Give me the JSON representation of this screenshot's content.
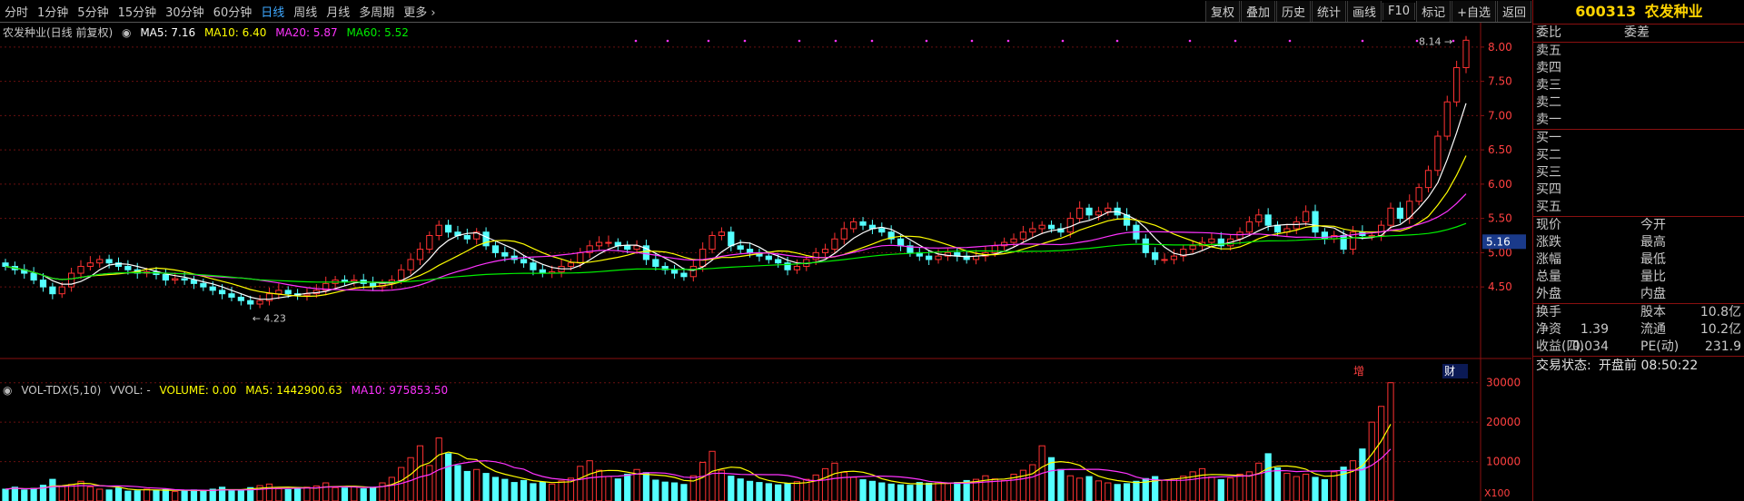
{
  "toolbar": {
    "periods": [
      "分时",
      "1分钟",
      "5分钟",
      "15分钟",
      "30分钟",
      "60分钟",
      "日线",
      "周线",
      "月线",
      "多周期",
      "更多"
    ],
    "more_chevron": "›",
    "active_period": "日线",
    "right_tools": [
      "复权",
      "叠加",
      "历史",
      "统计",
      "画线",
      "F10",
      "标记",
      "+自选",
      "返回"
    ]
  },
  "main_legend": {
    "title": "农发种业(日线 前复权)",
    "ma5": "MA5: 7.16",
    "ma10": "MA10: 6.40",
    "ma20": "MA20: 5.87",
    "ma60": "MA60: 5.52"
  },
  "vol_legend": {
    "name": "VOL-TDX(5,10)",
    "vvol": "VVOL: -",
    "volume": "VOLUME: 0.00",
    "ma5": "MA5: 1442900.63",
    "ma10": "MA10: 975853.50"
  },
  "chart_data": {
    "type": "candlestick",
    "price_axis": {
      "ticks": [
        "8.00",
        "7.50",
        "7.00",
        "6.50",
        "6.00",
        "5.50",
        "5.00",
        "4.50"
      ],
      "ylim": [
        4.25,
        8.25
      ]
    },
    "volume_axis": {
      "ticks": [
        "30000",
        "20000",
        "10000"
      ],
      "unit": "X100"
    },
    "annotations": {
      "high": "8.14",
      "low": "4.23",
      "current_price": "5.16",
      "marker_zeng": "增",
      "marker_cai": "财"
    },
    "colors": {
      "up": "#ff3232",
      "down": "#54ffff",
      "ma5": "#ffffff",
      "ma10": "#ffff00",
      "ma20": "#ff33ff",
      "ma60": "#00ee00"
    },
    "series": {
      "close": [
        4.8,
        4.75,
        4.7,
        4.6,
        4.5,
        4.4,
        4.5,
        4.7,
        4.8,
        4.85,
        4.9,
        4.85,
        4.8,
        4.75,
        4.7,
        4.72,
        4.68,
        4.6,
        4.62,
        4.6,
        4.55,
        4.5,
        4.45,
        4.4,
        4.35,
        4.3,
        4.25,
        4.3,
        4.4,
        4.45,
        4.4,
        4.38,
        4.4,
        4.45,
        4.55,
        4.6,
        4.58,
        4.6,
        4.55,
        4.5,
        4.55,
        4.6,
        4.75,
        4.9,
        5.05,
        5.25,
        5.4,
        5.3,
        5.25,
        5.2,
        5.3,
        5.1,
        5.0,
        4.95,
        4.9,
        4.85,
        4.75,
        4.7,
        4.72,
        4.8,
        4.85,
        5.0,
        5.1,
        5.15,
        5.15,
        5.1,
        5.05,
        5.1,
        4.9,
        4.8,
        4.75,
        4.7,
        4.65,
        4.8,
        5.05,
        5.25,
        5.3,
        5.1,
        5.05,
        5.0,
        4.95,
        4.9,
        4.85,
        4.75,
        4.8,
        4.9,
        5.0,
        5.05,
        5.2,
        5.35,
        5.45,
        5.4,
        5.35,
        5.3,
        5.2,
        5.1,
        5.0,
        4.95,
        4.9,
        4.95,
        5.0,
        4.95,
        4.9,
        4.95,
        5.0,
        5.1,
        5.15,
        5.2,
        5.3,
        5.35,
        5.4,
        5.35,
        5.3,
        5.5,
        5.65,
        5.55,
        5.6,
        5.65,
        5.55,
        5.4,
        5.2,
        5.0,
        4.9,
        4.9,
        4.95,
        5.05,
        5.1,
        5.15,
        5.2,
        5.1,
        5.2,
        5.3,
        5.45,
        5.55,
        5.4,
        5.3,
        5.35,
        5.45,
        5.6,
        5.3,
        5.2,
        5.25,
        5.05,
        5.3,
        5.25,
        5.25,
        5.4,
        5.65,
        5.5,
        5.75,
        5.95,
        6.2,
        6.7,
        7.2,
        7.7,
        8.1
      ],
      "open": [
        4.85,
        4.8,
        4.75,
        4.7,
        4.6,
        4.5,
        4.4,
        4.5,
        4.7,
        4.8,
        4.85,
        4.9,
        4.85,
        4.8,
        4.75,
        4.7,
        4.72,
        4.68,
        4.6,
        4.62,
        4.6,
        4.55,
        4.5,
        4.45,
        4.4,
        4.35,
        4.3,
        4.25,
        4.3,
        4.4,
        4.45,
        4.4,
        4.38,
        4.4,
        4.45,
        4.55,
        4.6,
        4.58,
        4.6,
        4.55,
        4.5,
        4.55,
        4.6,
        4.75,
        4.9,
        5.05,
        5.25,
        5.4,
        5.3,
        5.25,
        5.2,
        5.3,
        5.1,
        5.0,
        4.95,
        4.9,
        4.85,
        4.75,
        4.7,
        4.72,
        4.8,
        4.85,
        5.0,
        5.1,
        5.15,
        5.15,
        5.1,
        5.05,
        5.1,
        4.9,
        4.8,
        4.75,
        4.7,
        4.65,
        4.8,
        5.05,
        5.25,
        5.3,
        5.1,
        5.05,
        5.0,
        4.95,
        4.9,
        4.85,
        4.75,
        4.8,
        4.9,
        5.0,
        5.05,
        5.2,
        5.35,
        5.45,
        5.4,
        5.35,
        5.3,
        5.2,
        5.1,
        5.0,
        4.95,
        4.9,
        4.95,
        5.0,
        4.95,
        4.9,
        4.95,
        5.0,
        5.1,
        5.15,
        5.2,
        5.3,
        5.35,
        5.4,
        5.35,
        5.3,
        5.5,
        5.65,
        5.55,
        5.6,
        5.65,
        5.55,
        5.4,
        5.2,
        5.0,
        4.9,
        4.9,
        4.95,
        5.05,
        5.1,
        5.15,
        5.2,
        5.1,
        5.2,
        5.3,
        5.45,
        5.55,
        5.4,
        5.3,
        5.35,
        5.45,
        5.6,
        5.3,
        5.2,
        5.25,
        5.05,
        5.3,
        5.25,
        5.25,
        5.4,
        5.65,
        5.5,
        5.75,
        5.95,
        6.2,
        6.7,
        7.2,
        7.7
      ],
      "volume": [
        3000,
        3500,
        2800,
        3200,
        4000,
        5500,
        3800,
        4200,
        5000,
        3600,
        3000,
        2800,
        3300,
        2500,
        2600,
        3000,
        2700,
        2900,
        2400,
        2600,
        2800,
        2500,
        3000,
        3500,
        2600,
        2800,
        3400,
        3900,
        4300,
        3100,
        2900,
        3000,
        3500,
        3800,
        4600,
        3400,
        3300,
        3700,
        3100,
        3500,
        4600,
        6000,
        8500,
        11000,
        14000,
        9000,
        16000,
        12000,
        9000,
        7500,
        8000,
        7000,
        6000,
        5500,
        4700,
        5200,
        4400,
        4800,
        4300,
        5100,
        5800,
        8800,
        10200,
        7800,
        6200,
        5600,
        6800,
        8000,
        7200,
        5300,
        4800,
        4600,
        4200,
        6400,
        9800,
        12600,
        7800,
        6300,
        5600,
        5000,
        4700,
        4400,
        4100,
        4400,
        4900,
        5500,
        6600,
        8200,
        9600,
        7300,
        6000,
        5400,
        5000,
        4600,
        4300,
        4100,
        4000,
        4700,
        4500,
        4800,
        4400,
        4700,
        5200,
        5500,
        6400,
        5600,
        5200,
        6800,
        7800,
        9200,
        14000,
        11000,
        8000,
        6400,
        5800,
        6200,
        5100,
        4600,
        4200,
        4400,
        5000,
        5700,
        6200,
        5300,
        5600,
        6300,
        7400,
        8200,
        6100,
        5400,
        5800,
        6800,
        7400,
        9600,
        12000,
        8400,
        7000,
        6200,
        6800,
        6000,
        5400,
        7400,
        8600,
        10200,
        13200,
        20000,
        24000,
        30000
      ]
    }
  },
  "quote": {
    "code": "600313",
    "name": "农发种业",
    "weibi": "委比",
    "weicha": "委差",
    "sells": [
      "卖五",
      "卖四",
      "卖三",
      "卖二",
      "卖一"
    ],
    "buys": [
      "买一",
      "买二",
      "买三",
      "买四",
      "买五"
    ],
    "grid": [
      [
        "现价",
        "",
        "今开",
        ""
      ],
      [
        "涨跌",
        "",
        "最高",
        ""
      ],
      [
        "涨幅",
        "",
        "最低",
        ""
      ],
      [
        "总量",
        "",
        "量比",
        ""
      ],
      [
        "外盘",
        "",
        "内盘",
        ""
      ]
    ],
    "fund": [
      [
        "换手",
        "",
        "股本",
        "10.8亿"
      ],
      [
        "净资",
        "1.39",
        "流通",
        "10.2亿"
      ],
      [
        "收益(四)",
        "0.034",
        "PE(动)",
        "231.9"
      ]
    ],
    "status_label": "交易状态:",
    "status_value": "开盘前 08:50:22"
  }
}
